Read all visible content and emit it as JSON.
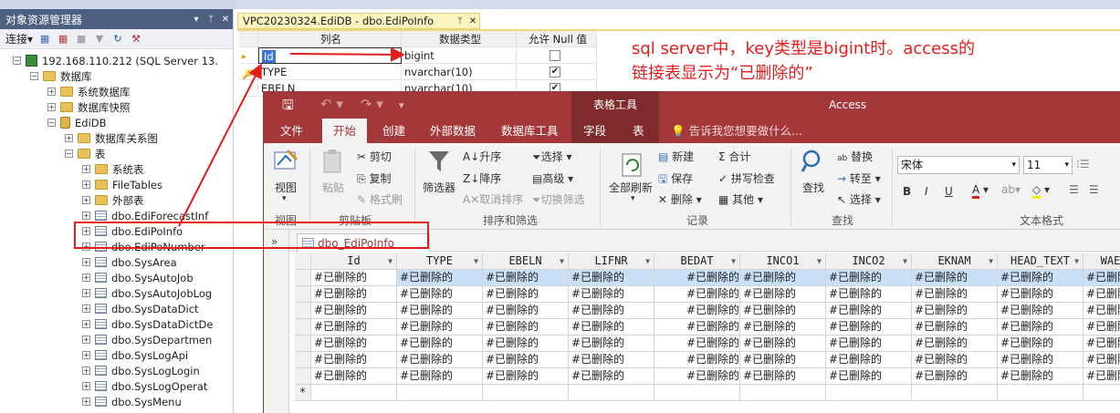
{
  "object_explorer": {
    "title": "对象资源管理器",
    "pin": "▾ ᛘ ✕",
    "toolbar": {
      "connect": "连接▾"
    },
    "server": "192.168.110.212 (SQL Server 13.",
    "databases": "数据库",
    "system_databases": "系统数据库",
    "db_snapshots": "数据库快照",
    "db_name": "EdiDB",
    "diagrams": "数据库关系图",
    "tables": "表",
    "system_tables": "系统表",
    "file_tables": "FileTables",
    "external_tables": "外部表",
    "table_items": [
      "dbo.EdiForecastInf",
      "dbo.EdiPoInfo",
      "dbo.EdiPoNumber",
      "dbo.SysArea",
      "dbo.SysAutoJob",
      "dbo.SysAutoJobLog",
      "dbo.SysDataDict",
      "dbo.SysDataDictDe",
      "dbo.SysDepartmen",
      "dbo.SysLogApi",
      "dbo.SysLogLogin",
      "dbo.SysLogOperat",
      "dbo.SysMenu"
    ]
  },
  "ssms_doc": {
    "tab_title": "VPC20230324.EdiDB - dbo.EdiPoInfo",
    "columns": [
      "列名",
      "数据类型",
      "允许 Null 值"
    ],
    "rows": [
      {
        "name": "Id",
        "type": "bigint",
        "nullable": false
      },
      {
        "name": "TYPE",
        "type": "nvarchar(10)",
        "nullable": true
      },
      {
        "name": "EBELN",
        "type": "nvarchar(10)",
        "nullable": true
      }
    ]
  },
  "annotation": {
    "line1": "sql server中，key类型是bigint时。access的",
    "line2": "链接表显示为“已删除的”"
  },
  "access": {
    "title_app": "Access",
    "context_tab": "表格工具",
    "menu": [
      "文件",
      "开始",
      "创建",
      "外部数据",
      "数据库工具",
      "字段",
      "表"
    ],
    "tell_me": "告诉我您想要做什么...",
    "ribbon": {
      "view": "视图",
      "paste": "粘贴",
      "cut": "剪切",
      "copy": "复制",
      "format_painter": "格式刷",
      "filter": "筛选器",
      "asc": "升序",
      "desc": "降序",
      "clear_sort": "取消排序",
      "select": "选择",
      "advanced": "高级",
      "toggle_filter": "切换筛选",
      "refresh_all": "全部刷新",
      "new": "新建",
      "save": "保存",
      "delete": "删除",
      "totals": "合计",
      "spelling": "拼写检查",
      "more": "其他",
      "find": "查找",
      "replace": "替换",
      "goto": "转至",
      "select2": "选择",
      "font": "宋体",
      "font_size": "11",
      "groups": [
        "视图",
        "剪贴板",
        "排序和筛选",
        "记录",
        "查找",
        "文本格式"
      ]
    },
    "nav_toggle": "»",
    "datasheet_tab": "dbo_EdiPoInfo",
    "columns": [
      "Id",
      "TYPE",
      "EBELN",
      "LIFNR",
      "BEDAT",
      "INCO1",
      "INCO2",
      "EKNAM",
      "HEAD_TEXT",
      "WAE"
    ],
    "deleted_value": "#已删除的",
    "row_count": 7,
    "new_row_marker": "*"
  }
}
